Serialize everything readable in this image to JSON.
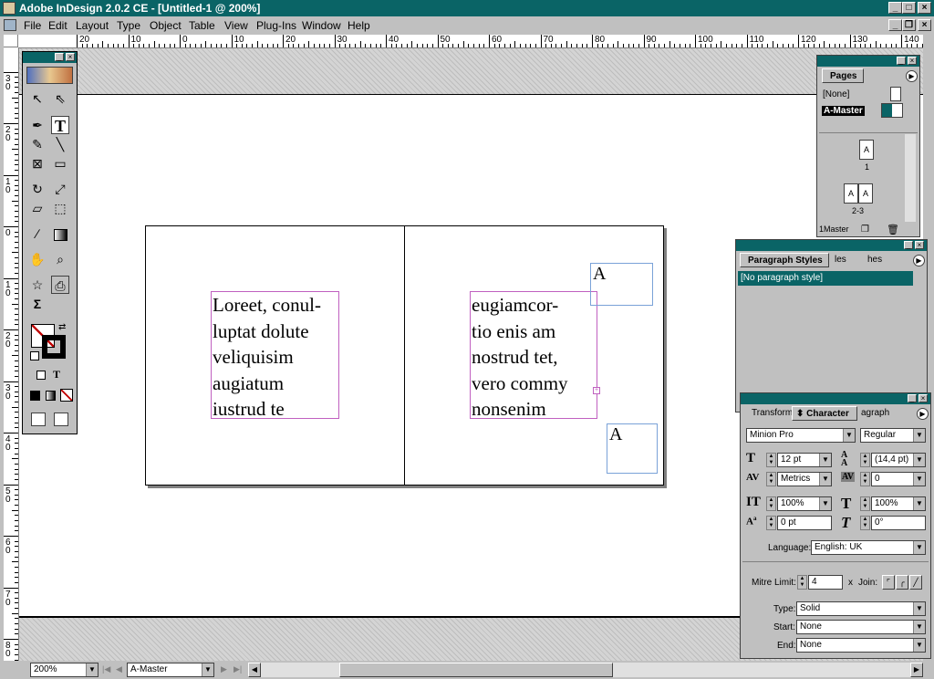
{
  "window": {
    "title": "Adobe InDesign 2.0.2 CE - [Untitled-1 @ 200%]",
    "title_color": "#0a6466"
  },
  "menu": [
    "File",
    "Edit",
    "Layout",
    "Type",
    "Object",
    "Table",
    "View",
    "Plug-Ins",
    "Window",
    "Help"
  ],
  "ruler": {
    "h_labels": [
      "20",
      "10",
      "0",
      "10",
      "20",
      "30",
      "40",
      "50",
      "60",
      "70",
      "80",
      "90",
      "100",
      "110",
      "120",
      "130",
      "140"
    ],
    "v_labels": [
      "3\n0",
      "2\n0",
      "1\n0",
      "0",
      "1\n0",
      "2\n0",
      "3\n0",
      "4\n0",
      "5\n0",
      "6\n0",
      "7\n0",
      "8\n0"
    ]
  },
  "document": {
    "left_text": "Loreet, conul-\nluptat dolute\nveliquisim\naugiatum\niustrud te",
    "right_text": "eugiamcor-\ntio enis am\nnostrud tet,\nvero commy\nnonsenim",
    "master_letter_top": "A",
    "master_letter_bottom": "A"
  },
  "toolbox": {
    "tools": [
      "selection-tool",
      "direct-selection-tool",
      "pen-tool",
      "type-tool",
      "pencil-tool",
      "line-tool",
      "rectangle-frame-tool",
      "rectangle-tool",
      "rotate-tool",
      "scale-tool",
      "shear-tool",
      "free-transform-tool",
      "eyedropper-tool",
      "gradient-tool",
      "hand-tool",
      "zoom-tool",
      "star-tool",
      "button-tool",
      "sigma-tool"
    ],
    "type_glyph": "T",
    "sigma_glyph": "Σ"
  },
  "pages_panel": {
    "tab": "Pages",
    "none_label": "[None]",
    "master_label": "A-Master",
    "page_1_letter": "A",
    "page_1_label": "1",
    "spread_letters": [
      "A",
      "A"
    ],
    "spread_label": "2-3",
    "footer": "1Master"
  },
  "paragraph_styles_panel": {
    "tabs": [
      "Paragraph Styles",
      "les",
      "hes"
    ],
    "item": "[No paragraph style]"
  },
  "character_panel": {
    "tabs": [
      "Transform",
      "Character",
      "agraph"
    ],
    "font": "Minion Pro",
    "style": "Regular",
    "size": "12 pt",
    "leading": "(14,4 pt)",
    "kerning": "Metrics",
    "tracking": "0",
    "vertical_scale": "100%",
    "horizontal_scale": "100%",
    "baseline_shift": "0 pt",
    "skew": "0°",
    "language_label": "Language:",
    "language": "English: UK"
  },
  "stroke_panel": {
    "mitre_label": "Mitre Limit:",
    "mitre_value": "4",
    "mitre_unit": "x",
    "join_label": "Join:",
    "type_label": "Type:",
    "type_value": "Solid",
    "start_label": "Start:",
    "start_value": "None",
    "end_label": "End:",
    "end_value": "None"
  },
  "status": {
    "zoom": "200%",
    "page": "A-Master"
  }
}
